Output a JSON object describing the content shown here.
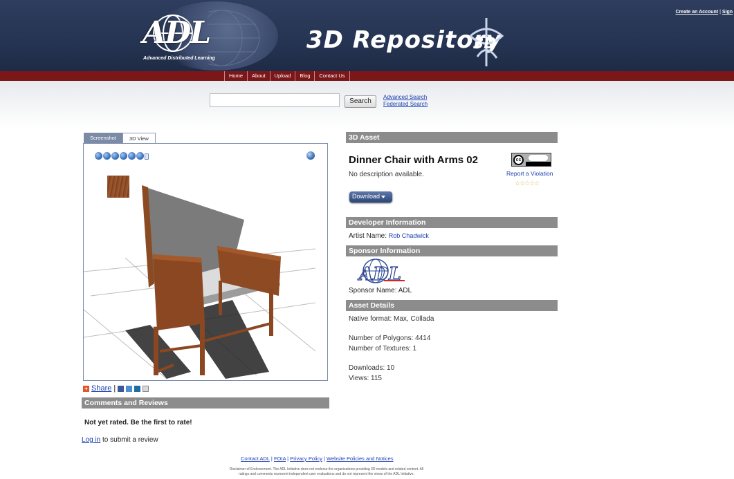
{
  "header": {
    "logo_text": "ADL",
    "logo_subtitle": "Advanced Distributed Learning",
    "site_title": "3D Repository",
    "account_links": [
      "Create an Account",
      "Sign"
    ]
  },
  "nav": {
    "items": [
      "Home",
      "About",
      "Upload",
      "Blog",
      "Contact Us"
    ]
  },
  "search": {
    "value": "",
    "button_label": "Search",
    "advanced_link": "Advanced Search",
    "federated_link": "Federated Search"
  },
  "viewer": {
    "tabs": [
      "Screenshot",
      "3D View"
    ],
    "active_tab": "3D View",
    "toolbar_icons": [
      "orbit-icon",
      "pan-icon",
      "zoom-icon",
      "fly-icon",
      "rotate-icon",
      "light-icon",
      "help-icon"
    ]
  },
  "share": {
    "label": "Share",
    "separator": "|",
    "networks": [
      "facebook-icon",
      "twitter-icon",
      "linkedin-icon",
      "more-icon"
    ]
  },
  "comments": {
    "heading": "Comments and Reviews",
    "rating_message": "Not yet rated. Be the first to rate!",
    "login_link": "Log in",
    "login_suffix": " to submit a review"
  },
  "asset": {
    "heading": "3D Asset",
    "title": "Dinner Chair with Arms 02",
    "description": "No description available.",
    "report_link": "Report a Violation",
    "rating_stars": 0,
    "download_label": "Download"
  },
  "developer": {
    "heading": "Developer Information",
    "artist_label": "Artist Name:",
    "artist_name": "Rob Chadwick"
  },
  "sponsor": {
    "heading": "Sponsor Information",
    "logo_text": "ADL",
    "sponsor_label": "Sponsor Name:",
    "sponsor_name": "ADL"
  },
  "details": {
    "heading": "Asset Details",
    "native_format": "Native format: Max, Collada",
    "polygons": "Number of Polygons: 4414",
    "textures": "Number of Textures: 1",
    "downloads": "Downloads: 10",
    "views": "Views: 115"
  },
  "footer": {
    "links": [
      "Contact ADL",
      "FOIA",
      "Privacy Policy",
      "Website Policies and Notices"
    ],
    "disclaimer_line1": "Disclaimer of Endorsement. The ADL Initiative does not endorse the organizations providing 3D models and related content. All",
    "disclaimer_line2": "ratings and comments represent independent user evaluations and do not represent the views of the ADL Initiative."
  },
  "colors": {
    "header_bg": "#253452",
    "nav_bg": "#7b1719",
    "section_bar": "#8c8c8c",
    "link": "#1a3eb0"
  }
}
